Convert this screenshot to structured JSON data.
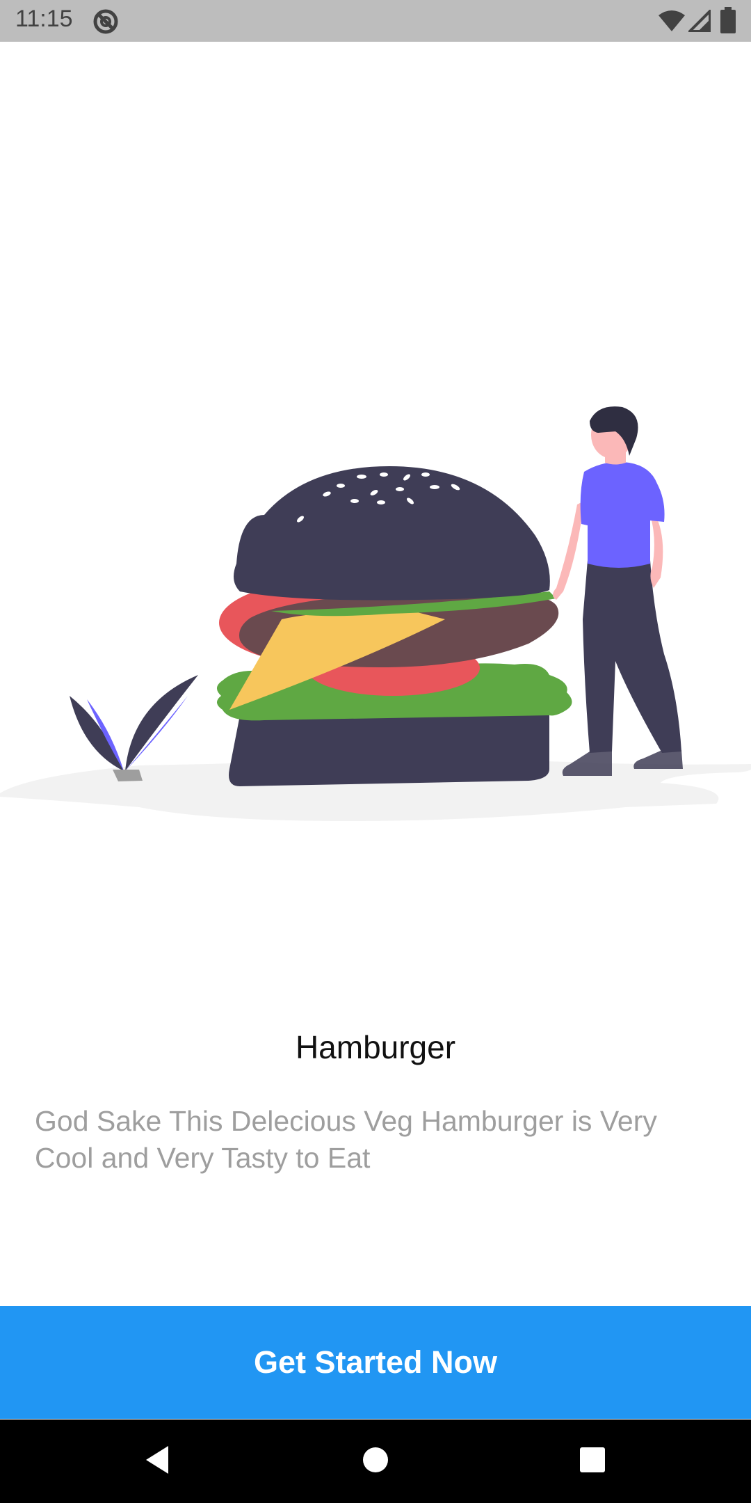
{
  "status_bar": {
    "time": "11:15",
    "icons": [
      "do-not-disturb-icon",
      "wifi-icon",
      "cellular-signal-icon",
      "battery-icon"
    ]
  },
  "illustration": {
    "subject": "hamburger-with-person-illustration",
    "colors": {
      "bun": "#3f3d56",
      "lettuce": "#5fa843",
      "tomato": "#e8565b",
      "patty": "#6a4a4f",
      "cheese": "#f7c65c",
      "shirt": "#6c63ff",
      "skin": "#fbb8b8",
      "ground": "#f2f2f2"
    }
  },
  "content": {
    "title": "Hamburger",
    "description": "God Sake This Delecious Veg Hamburger is Very Cool and Very Tasty to Eat"
  },
  "cta": {
    "label": "Get Started Now",
    "color": "#2196f3"
  },
  "nav_bar": {
    "buttons": [
      "back-icon",
      "home-icon",
      "recents-icon"
    ]
  }
}
